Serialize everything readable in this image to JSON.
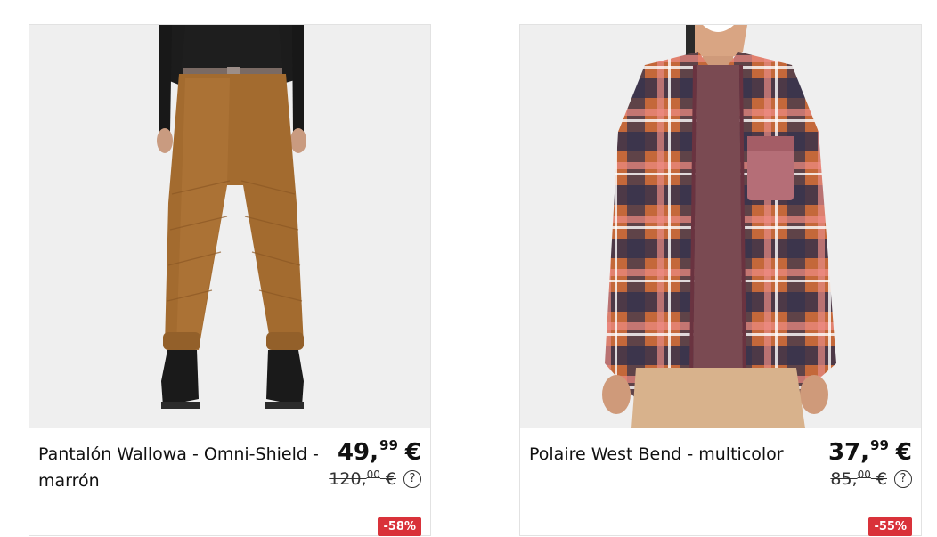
{
  "products": [
    {
      "name": "Pantalón Wallowa - Omni-Shield - marrón",
      "price_int": "49,",
      "price_dec": "99",
      "currency": "€",
      "old_int": "120,",
      "old_dec": "00",
      "old_currency": "€",
      "discount": "-58%",
      "help": "?"
    },
    {
      "name": "Polaire West Bend - multicolor",
      "price_int": "37,",
      "price_dec": "99",
      "currency": "€",
      "old_int": "85,",
      "old_dec": "00",
      "old_currency": "€",
      "discount": "-55%",
      "help": "?"
    }
  ],
  "colors": {
    "discount_badge": "#d9323a",
    "image_bg": "#efefef"
  }
}
